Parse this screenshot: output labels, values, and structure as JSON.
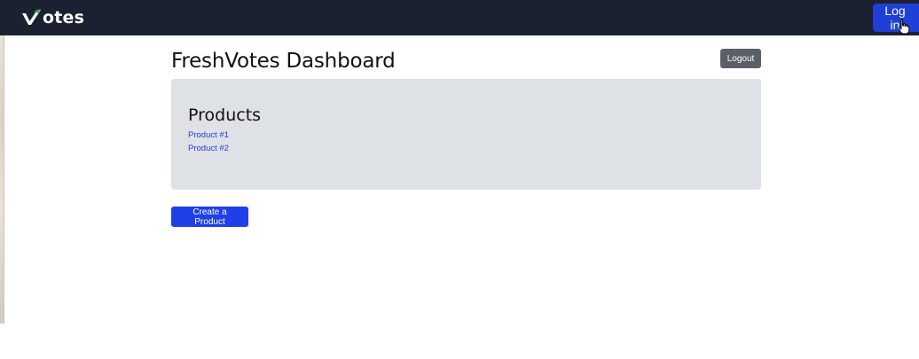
{
  "navbar": {
    "brand": "otes",
    "brand_icon": "check-v-icon",
    "login_label": "Log in",
    "background": "#1b2131",
    "login_color": "#1f3fd6"
  },
  "header": {
    "title": "FreshVotes Dashboard",
    "logout_label": "Logout"
  },
  "products": {
    "heading": "Products",
    "items": [
      {
        "label": "Product #1"
      },
      {
        "label": "Product #2"
      }
    ],
    "panel_color": "#dee1e5"
  },
  "actions": {
    "create_label": "Create a Product",
    "accent": "#1f3fe8"
  }
}
